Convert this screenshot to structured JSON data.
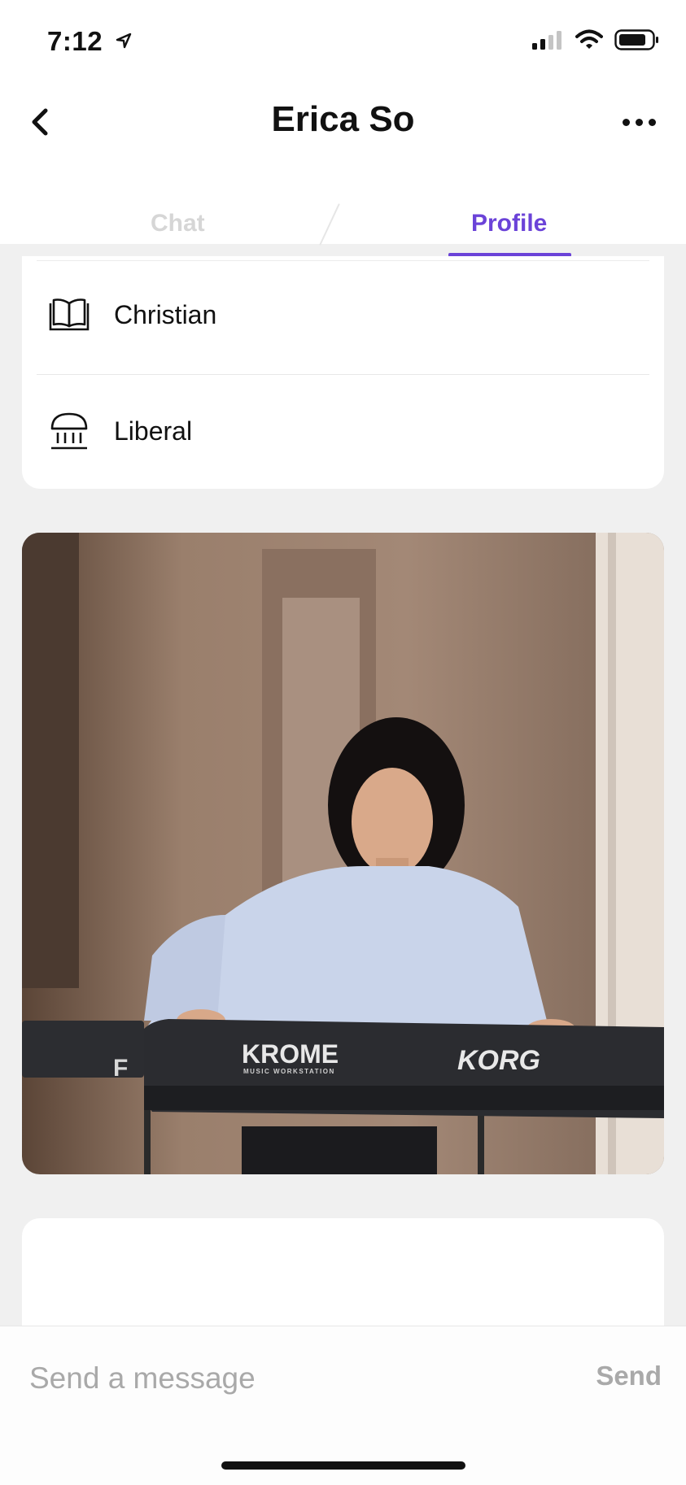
{
  "status_bar": {
    "time": "7:12",
    "icons": [
      "location-arrow-icon",
      "signal-icon",
      "wifi-icon",
      "battery-icon"
    ]
  },
  "header": {
    "title": "Erica So",
    "back_icon": "chevron-left-icon",
    "more_icon": "more-dots-icon"
  },
  "tabs": [
    {
      "label": "Chat",
      "active": false
    },
    {
      "label": "Profile",
      "active": true
    }
  ],
  "profile": {
    "details": [
      {
        "icon": "book-icon",
        "label": "Christian"
      },
      {
        "icon": "government-building-icon",
        "label": "Liberal"
      }
    ],
    "photo": {
      "keyboard_brand": "KORG",
      "keyboard_model": "KROME",
      "keyboard_subtitle": "MUSIC WORKSTATION"
    }
  },
  "composer": {
    "placeholder": "Send a message",
    "value": "",
    "send_label": "Send"
  },
  "colors": {
    "accent": "#6b43d8",
    "inactive_tab": "#d6d6d6",
    "background": "#f0f0f0"
  }
}
